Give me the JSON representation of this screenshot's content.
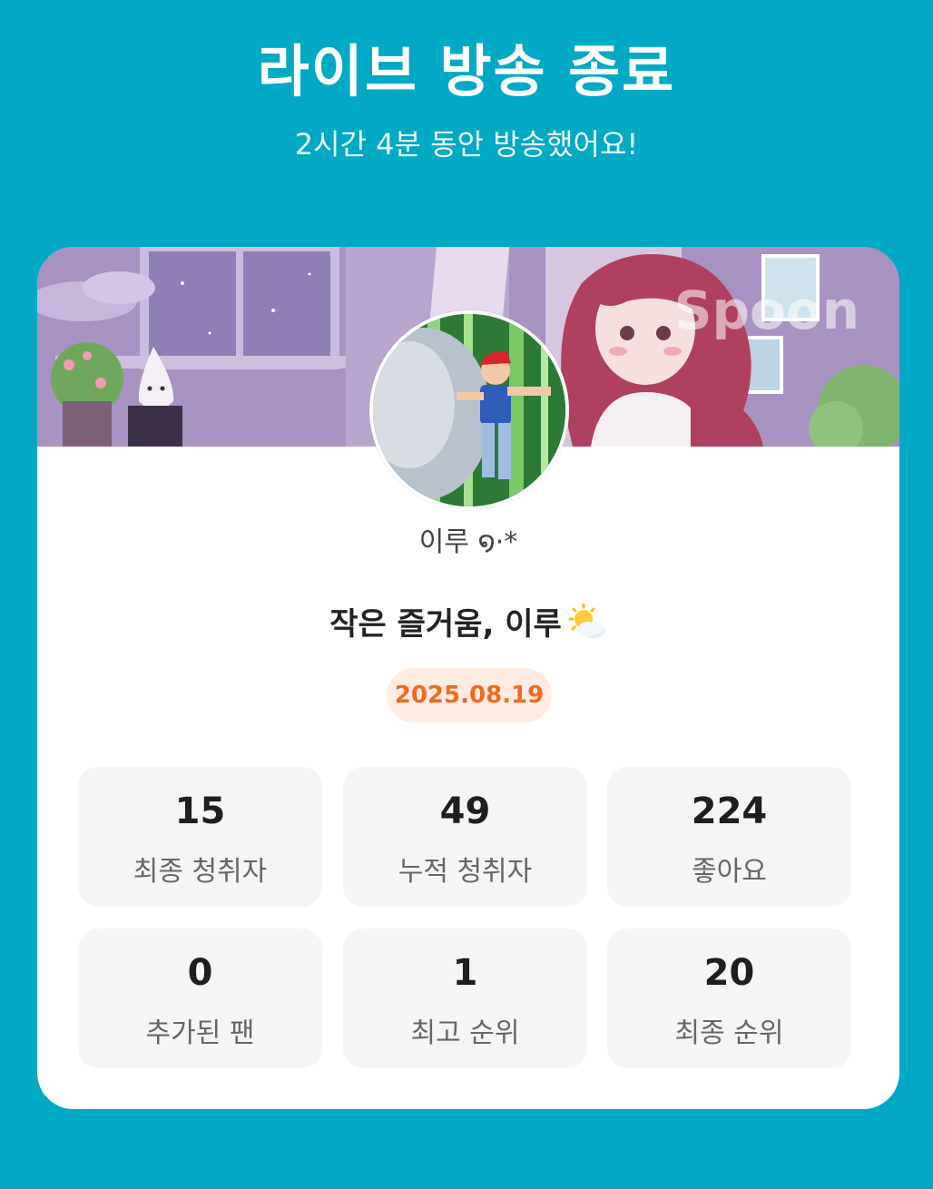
{
  "header": {
    "title": "라이브 방송 종료",
    "subtitle": "2시간 4분 동안 방송했어요!"
  },
  "card": {
    "banner_watermark": "Spoon",
    "nickname": "이루 ໑·*",
    "live_title": "작은 즐거움, 이루",
    "title_icon": "sun-behind-cloud-icon",
    "date": "2025.08.19"
  },
  "stats": [
    {
      "value": "15",
      "label": "최종 청취자"
    },
    {
      "value": "49",
      "label": "누적 청취자"
    },
    {
      "value": "224",
      "label": "좋아요"
    },
    {
      "value": "0",
      "label": "추가된 팬"
    },
    {
      "value": "1",
      "label": "최고 순위"
    },
    {
      "value": "20",
      "label": "최종 순위"
    }
  ],
  "colors": {
    "background": "#00a9c4",
    "card": "#ffffff",
    "date_text": "#f26a1f",
    "date_badge": "#ffebe2",
    "stat_tile": "#f5f5f5"
  }
}
